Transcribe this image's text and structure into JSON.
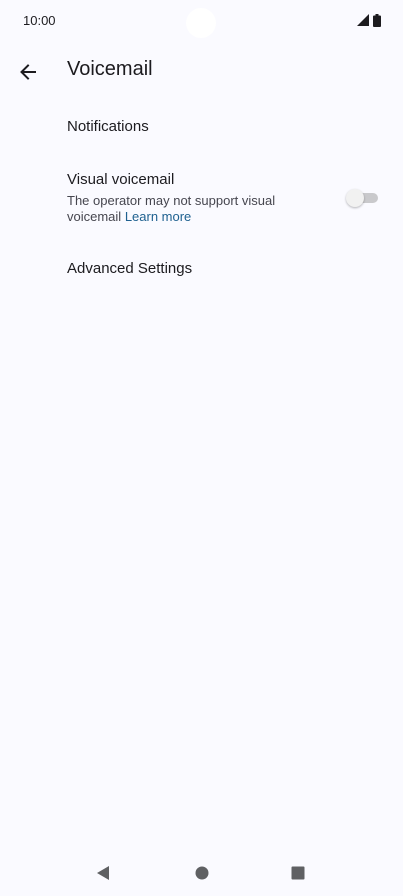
{
  "status_bar": {
    "time": "10:00",
    "icons": [
      "signal-icon",
      "battery-icon"
    ]
  },
  "app_bar": {
    "back_icon": "arrow-back-icon",
    "title": "Voicemail"
  },
  "settings": {
    "notifications": {
      "title": "Notifications"
    },
    "visual_voicemail": {
      "title": "Visual voicemail",
      "summary": "The operator may not support visual voicemail",
      "link": "Learn more",
      "enabled": false
    },
    "advanced": {
      "title": "Advanced Settings"
    }
  },
  "navigation_bar": {
    "icons": [
      "back-triangle-icon",
      "home-circle-icon",
      "recents-square-icon"
    ]
  },
  "colors": {
    "background": "#fafaff",
    "link": "#1f6190",
    "text": "#1c1b1f"
  }
}
